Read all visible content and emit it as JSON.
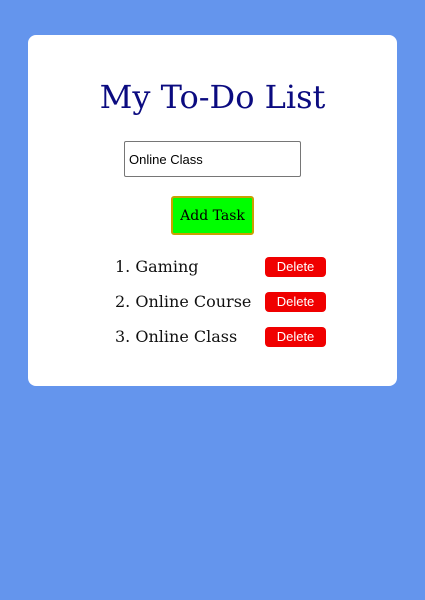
{
  "app": {
    "title": "My To-Do List"
  },
  "form": {
    "input_value": "Online Class",
    "add_button_label": "Add Task"
  },
  "tasks": [
    {
      "label": "1. Gaming",
      "delete_label": "Delete"
    },
    {
      "label": "2. Online Course",
      "delete_label": "Delete"
    },
    {
      "label": "3. Online Class",
      "delete_label": "Delete"
    }
  ],
  "colors": {
    "background": "#6495ED",
    "card": "#FFFFFF",
    "title": "#0B0B80",
    "add_button": "#00FF00",
    "delete_button": "#F00000"
  }
}
